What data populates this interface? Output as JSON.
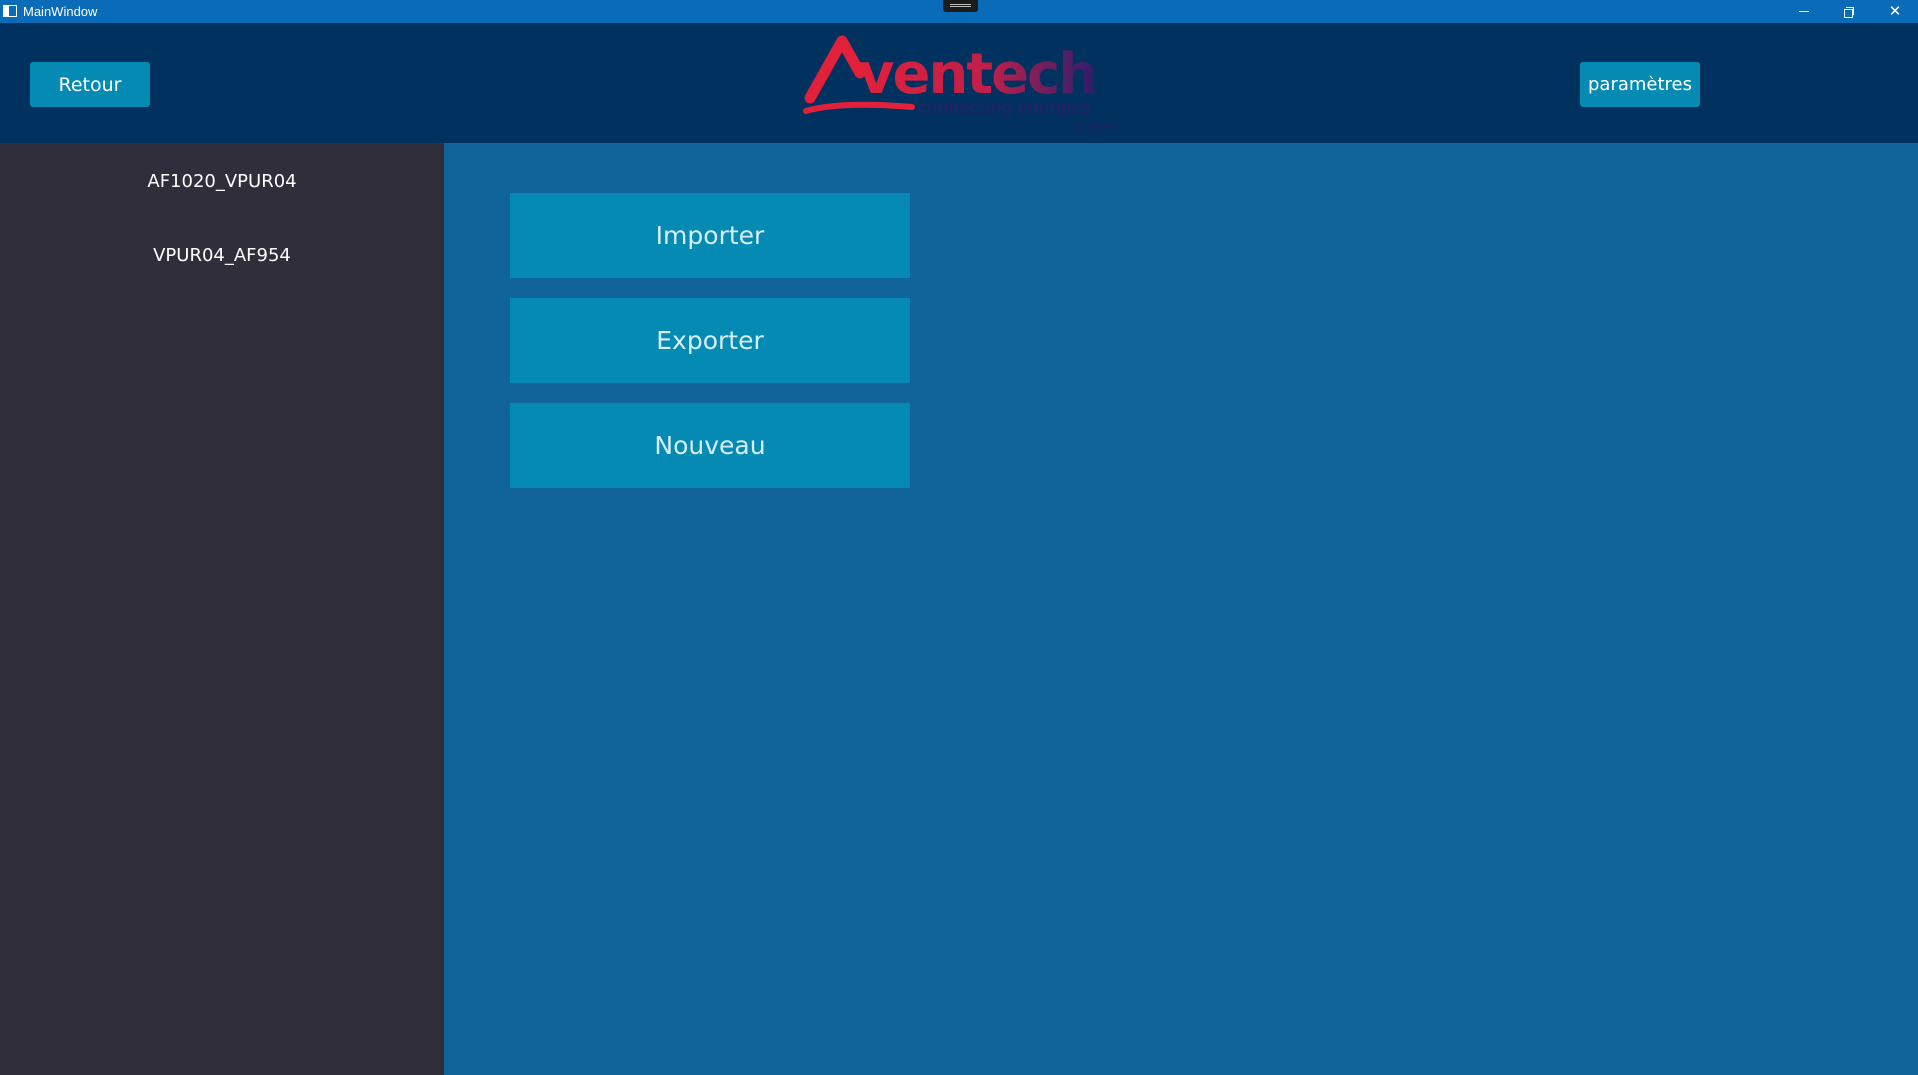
{
  "window": {
    "title": "MainWindow",
    "close_glyph": "✕"
  },
  "header": {
    "back_label": "Retour",
    "settings_label": "paramètres",
    "logo": {
      "brand": "Aventech",
      "tagline": "connecting energies",
      "byline": "by Kryes",
      "color_primary": "#e3203a",
      "color_secondary": "#2b1e6e"
    }
  },
  "sidebar": {
    "items": [
      {
        "label": "AF1020_VPUR04"
      },
      {
        "label": "VPUR04_AF954"
      }
    ]
  },
  "main": {
    "actions": [
      {
        "label": "Importer"
      },
      {
        "label": "Exporter"
      },
      {
        "label": "Nouveau"
      }
    ]
  },
  "colors": {
    "titlebar": "#0a6bb8",
    "header_bg": "#01315f",
    "sidebar_bg": "#2f2e3a",
    "main_bg": "#11649a",
    "button_bg": "#058bb3"
  }
}
